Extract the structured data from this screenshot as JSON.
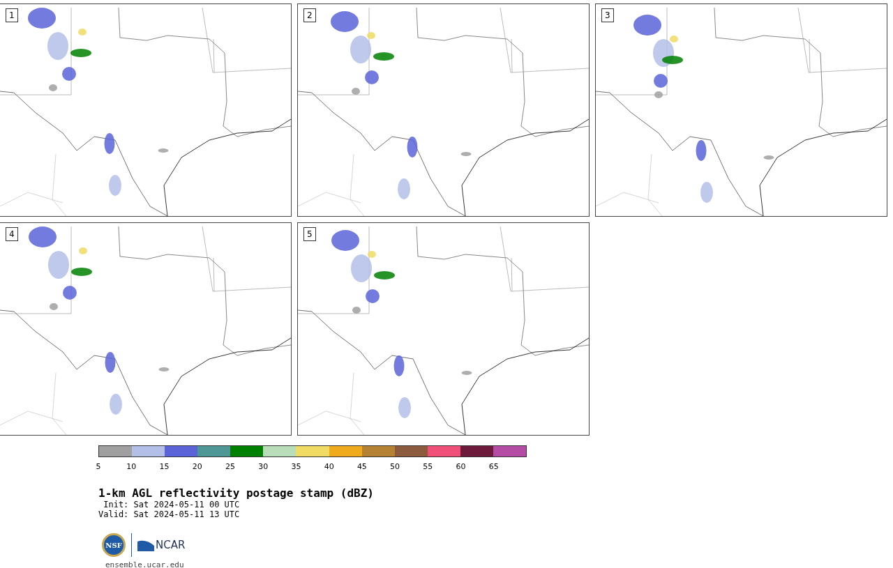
{
  "panels": [
    {
      "label": "1"
    },
    {
      "label": "2"
    },
    {
      "label": "3"
    },
    {
      "label": "4"
    },
    {
      "label": "5"
    }
  ],
  "colorbar": {
    "bins": [
      {
        "color": "#a0a0a0"
      },
      {
        "color": "#b4bfe8"
      },
      {
        "color": "#5a64d8"
      },
      {
        "color": "#4f9696"
      },
      {
        "color": "#008000"
      },
      {
        "color": "#b9dcb9"
      },
      {
        "color": "#f0dc64"
      },
      {
        "color": "#f0aa1e"
      },
      {
        "color": "#b48232"
      },
      {
        "color": "#8c5a3c"
      },
      {
        "color": "#f05078"
      },
      {
        "color": "#6e1a3c"
      },
      {
        "color": "#b44ba5"
      }
    ],
    "ticks": [
      "5",
      "10",
      "15",
      "20",
      "25",
      "30",
      "35",
      "40",
      "45",
      "50",
      "55",
      "60",
      "65"
    ]
  },
  "title": "1-km AGL reflectivity postage stamp (dBZ)",
  "init": " Init: Sat 2024-05-11 00 UTC",
  "valid": "Valid: Sat 2024-05-11 13 UTC",
  "logos": {
    "nsf": "NSF",
    "ncar": "NCAR"
  },
  "url": "ensemble.ucar.edu"
}
